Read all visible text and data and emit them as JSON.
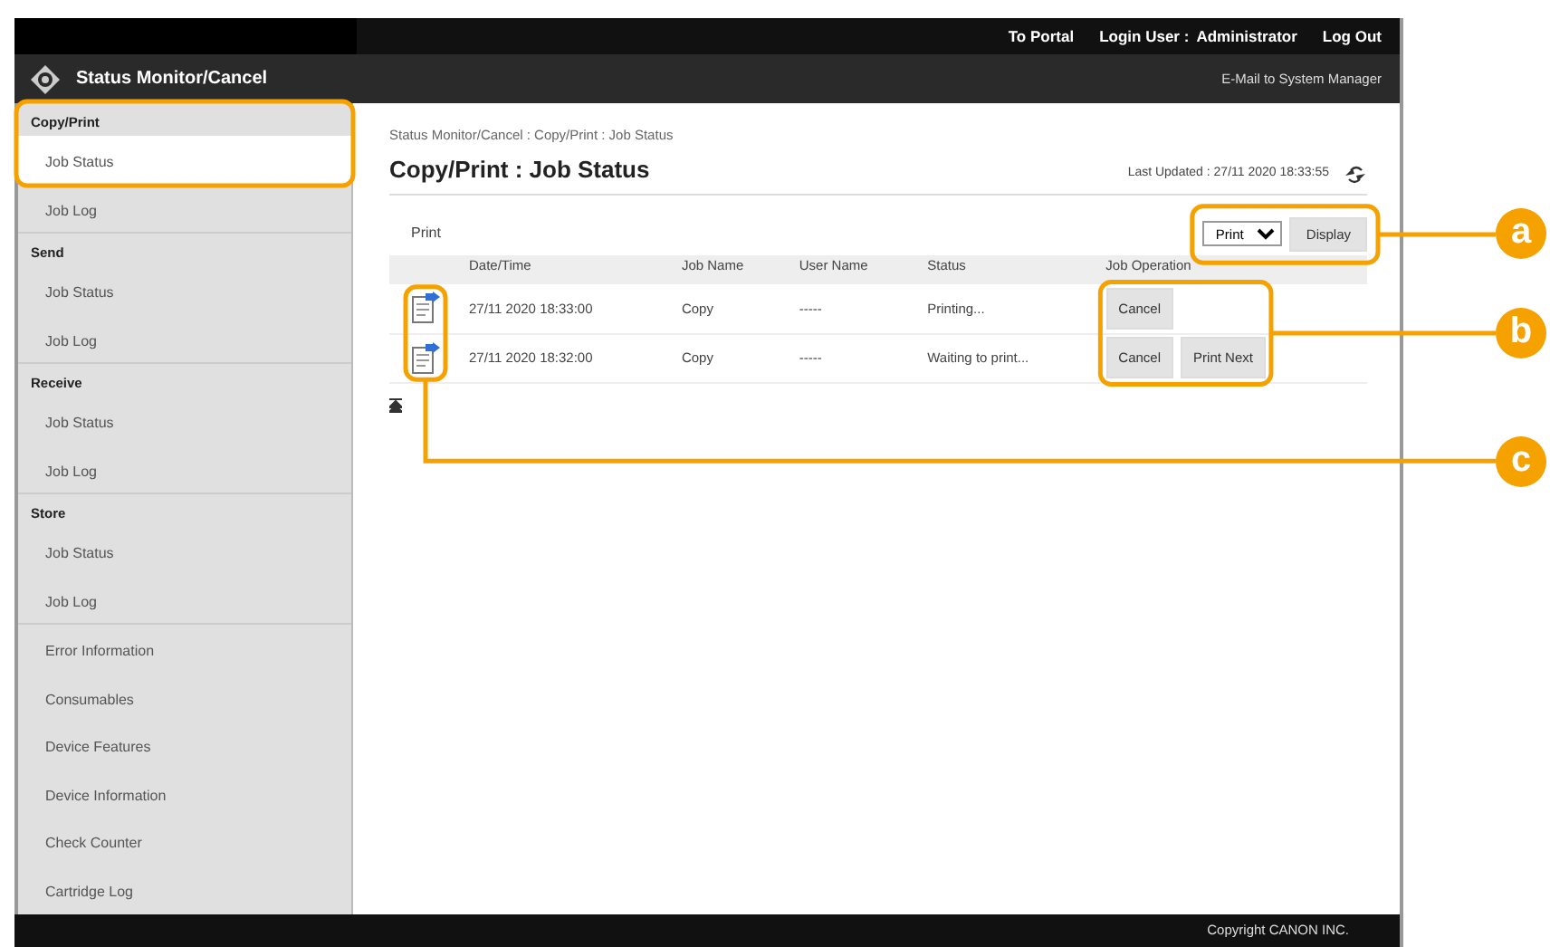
{
  "top_bar": {
    "portal_link": "To Portal",
    "login_label": "Login User :",
    "login_user": "Administrator",
    "logout_link": "Log Out"
  },
  "title_bar": {
    "title": "Status Monitor/Cancel",
    "mail_link": "E-Mail to System Manager"
  },
  "sidebar": {
    "sections": [
      {
        "title": "Copy/Print",
        "items": [
          {
            "label": "Job Status",
            "selected": true
          },
          {
            "label": "Job Log",
            "selected": false
          }
        ]
      },
      {
        "title": "Send",
        "items": [
          {
            "label": "Job Status",
            "selected": false
          },
          {
            "label": "Job Log",
            "selected": false
          }
        ]
      },
      {
        "title": "Receive",
        "items": [
          {
            "label": "Job Status",
            "selected": false
          },
          {
            "label": "Job Log",
            "selected": false
          }
        ]
      },
      {
        "title": "Store",
        "items": [
          {
            "label": "Job Status",
            "selected": false
          },
          {
            "label": "Job Log",
            "selected": false
          }
        ]
      }
    ],
    "items": [
      {
        "label": "Error Information",
        "selected": false
      },
      {
        "label": "Consumables",
        "selected": false
      },
      {
        "label": "Device Features",
        "selected": false
      },
      {
        "label": "Device Information",
        "selected": false
      },
      {
        "label": "Check Counter",
        "selected": false
      },
      {
        "label": "Cartridge Log",
        "selected": false
      }
    ]
  },
  "content": {
    "breadcrumb": "Status Monitor/Cancel : Copy/Print : Job Status",
    "title": "Copy/Print : Job Status",
    "last_updated": "Last Updated : 27/11 2020 18:33:55",
    "filter_label": "Print",
    "filter_value": "Print",
    "display_button": "Display"
  },
  "table": {
    "columns": [
      "Date/Time",
      "Job Name",
      "User Name",
      "Status",
      "Job Operation"
    ],
    "rows": [
      {
        "date_time": "27/11 2020 18:33:00",
        "job_name": "Copy",
        "user_name": "-----",
        "status": "Printing...",
        "operations": [
          "Cancel"
        ]
      },
      {
        "date_time": "27/11 2020 18:32:00",
        "job_name": "Copy",
        "user_name": "-----",
        "status": "Waiting to print...",
        "operations": [
          "Cancel",
          "Print Next"
        ]
      }
    ]
  },
  "footer": {
    "copyright": "Copyright CANON INC."
  },
  "callouts": [
    {
      "letter": "a"
    },
    {
      "letter": "b"
    },
    {
      "letter": "c"
    }
  ]
}
